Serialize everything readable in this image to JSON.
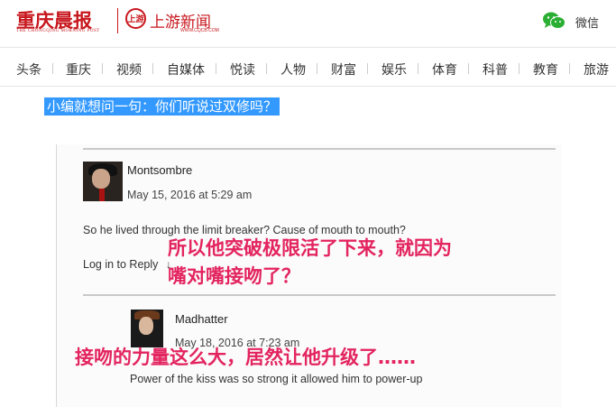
{
  "header": {
    "brand_primary": "重庆晨报",
    "brand_primary_sub": "THE CHONGQING MORNING POST",
    "brand_secondary_logo": "上游",
    "brand_secondary": "上游新闻",
    "brand_secondary_sub": "WWW.CQCB.COM",
    "wechat_label": "微信",
    "accent_color": "#c8161d",
    "wechat_color": "#2aae33"
  },
  "nav": {
    "items": [
      {
        "label": "头条"
      },
      {
        "label": "重庆"
      },
      {
        "label": "视频"
      },
      {
        "label": "自媒体"
      },
      {
        "label": "悦读"
      },
      {
        "label": "人物"
      },
      {
        "label": "财富"
      },
      {
        "label": "娱乐"
      },
      {
        "label": "体育"
      },
      {
        "label": "科普"
      },
      {
        "label": "教育"
      },
      {
        "label": "旅游"
      }
    ]
  },
  "article": {
    "headline": "小编就想问一句：你们听说过双修吗？",
    "highlight_color": "#3399ff",
    "screenshot": {
      "comments": [
        {
          "author": "Montsombre",
          "date": "May 15, 2016 at 5:29 am",
          "text": "So he lived through the limit breaker? Cause of mouth to mouth?",
          "reply_label": "Log in to Reply",
          "reply_icon": "↓"
        },
        {
          "author": "Madhatter",
          "date": "May 18, 2016 at 7:23 am",
          "text": "Power of the kiss was so strong it allowed him to power-up"
        }
      ],
      "overlay_caption_1": [
        "所以他突破极限活了下来，就因为",
        "嘴对嘴接吻了？"
      ],
      "overlay_caption_2": "接吻的力量这么大，居然让他升级了……",
      "overlay_color": "#e3245f"
    }
  }
}
